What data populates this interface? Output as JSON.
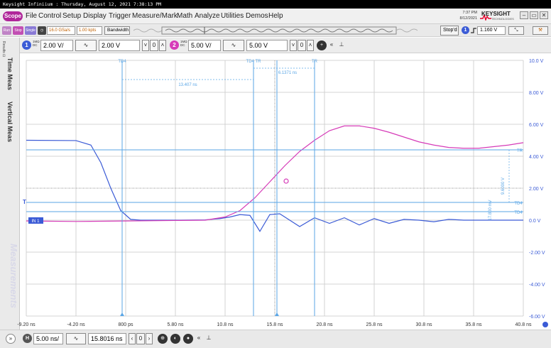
{
  "titlebar": {
    "text": "Keysight Infiniium : Thursday, August 12, 2021 7:38:13 PM"
  },
  "menu": {
    "logo": "Scope",
    "items": [
      "File",
      "Control",
      "Setup",
      "Display",
      "Trigger",
      "Measure/Mark",
      "Math",
      "Analyze",
      "Utilities",
      "Demos",
      "Help"
    ],
    "clock_time": "7:37 PM",
    "clock_date": "8/12/2021",
    "brand": "KEYSIGHT",
    "brand_sub": "TECHNOLOGIES"
  },
  "acquisition": {
    "run": "Run",
    "stop": "Stop",
    "single": "Single",
    "sample_rate": "16.0 GSa/s",
    "memory_depth": "1.00 kpts",
    "bandwidth": "Bandwidth",
    "stopd": "Stop'd",
    "trigger_channel": "1",
    "trigger_level": "1.160 V"
  },
  "channels": [
    {
      "num": "1",
      "imp": "1MΩ",
      "coup": "DC",
      "scale": "2.00 V/",
      "offset": "2.00 V",
      "color": "#3b5bd6"
    },
    {
      "num": "2",
      "imp": "1MΩ",
      "coup": "DC",
      "scale": "5.00 V/",
      "offset": "5.00 V",
      "color": "#d63bb8"
    }
  ],
  "side_tabs": [
    "Time Meas",
    "Vertical Meas"
  ],
  "side_watermark": "Measurements",
  "side_top": "Results ⊡",
  "y_axis": [
    "10.0 V",
    "8.00 V",
    "6.00 V",
    "4.00 V",
    "2.00 V",
    "0.0 V",
    "-2.00 V",
    "-4.00 V",
    "-6.00 V"
  ],
  "x_axis": [
    "-9.20 ns",
    "-4.20 ns",
    "800 ps",
    "5.80 ns",
    "10.8 ns",
    "15.8 ns",
    "20.8 ns",
    "25.8 ns",
    "30.8 ns",
    "35.8 ns",
    "40.8 ns"
  ],
  "markers": {
    "td4": "TD4",
    "tr": "TR",
    "tdtr": "TD4 TR",
    "dt1": "13.407 ns",
    "dt2": "6.1371 ns",
    "right_tr": "TR",
    "right_td4": "TD4",
    "right_tdx": "TD4",
    "dv1": "9.6000 V",
    "dv2": "17.800 mV",
    "ch1_marker": "IN 1",
    "trig_marker": "T"
  },
  "colors": {
    "ch1": "#3b5bd6",
    "ch2": "#d63bb8",
    "marker": "#5aa6e6",
    "grid": "#c8c8c8"
  },
  "chart_data": {
    "type": "line",
    "x_unit": "ns",
    "y_unit": "V",
    "xlim": [
      -9.2,
      40.8
    ],
    "ylim": [
      -6.0,
      10.0
    ],
    "series": [
      {
        "x": [
          -9.2,
          -4.2,
          -2.7,
          -1.7,
          -0.7,
          0.3,
          1.3,
          2.3,
          5.8,
          8.8,
          10.3,
          11.3,
          12.3,
          13.3,
          14.3,
          15.3,
          16.3,
          17.3,
          18.3,
          19.8,
          21.3,
          22.8,
          24.3,
          25.8,
          27.3,
          28.8,
          30.3,
          31.8,
          33.3,
          34.8,
          36.3,
          37.8,
          39.3,
          40.8
        ],
        "values": [
          5.0,
          4.98,
          4.7,
          3.6,
          2.0,
          0.6,
          0.05,
          0.0,
          0.0,
          0.02,
          0.1,
          0.2,
          0.35,
          0.3,
          -0.7,
          0.35,
          0.4,
          0.0,
          -0.4,
          0.15,
          -0.2,
          0.15,
          -0.3,
          0.1,
          -0.2,
          0.05,
          0.0,
          -0.1,
          0.05,
          0.0,
          0.0,
          0.0,
          0.0,
          0.0
        ]
      },
      {
        "x": [
          -9.2,
          -4.2,
          0.8,
          5.8,
          8.8,
          10.8,
          12.3,
          13.8,
          15.3,
          16.8,
          18.3,
          19.8,
          21.3,
          22.8,
          24.3,
          25.8,
          27.3,
          28.8,
          30.3,
          31.8,
          33.3,
          34.8,
          36.3,
          37.8,
          39.3,
          40.8
        ],
        "values": [
          -0.05,
          -0.08,
          -0.05,
          -0.02,
          0.0,
          0.2,
          0.6,
          1.4,
          2.4,
          3.4,
          4.3,
          5.0,
          5.6,
          5.9,
          5.9,
          5.75,
          5.5,
          5.2,
          4.9,
          4.7,
          4.55,
          4.5,
          4.5,
          4.6,
          4.7,
          4.85
        ]
      }
    ]
  }
}
